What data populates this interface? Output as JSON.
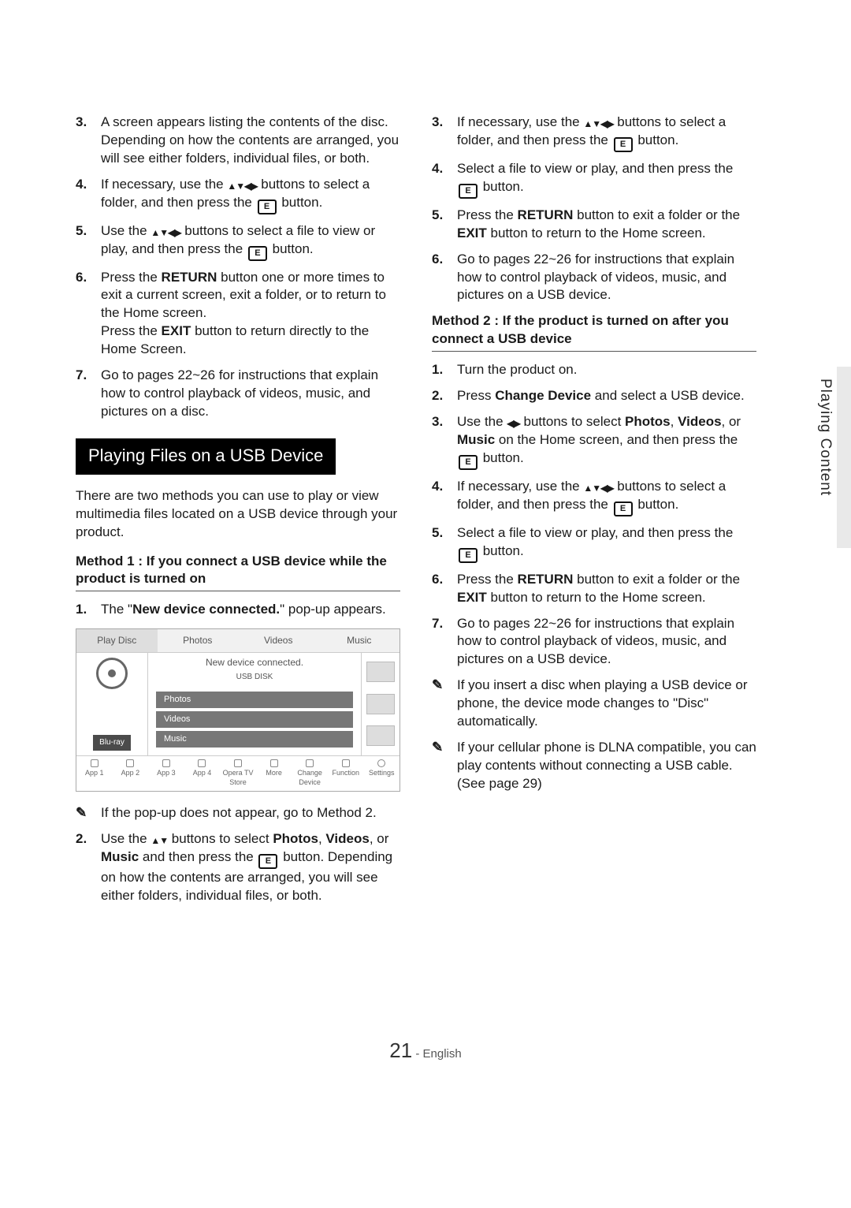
{
  "page": {
    "number": "21",
    "language_label": "- English"
  },
  "sidetab": {
    "label": "Playing Content"
  },
  "icons": {
    "dpad4": "▲▼◀▶",
    "dpad2ud": "▲▼",
    "dpad2lr": "◀▶",
    "enter_glyph": "E"
  },
  "left": {
    "steps_top": [
      {
        "n": "3.",
        "text": "A screen appears listing the contents of the disc. Depending on how the contents are arranged, you will see either folders, individual files, or both."
      },
      {
        "n": "4.",
        "segs": [
          {
            "t": "If necessary, use the "
          },
          {
            "dpad": "dpad4"
          },
          {
            "t": " buttons to select a folder, and then press the "
          },
          {
            "enter": true
          },
          {
            "t": " button."
          }
        ]
      },
      {
        "n": "5.",
        "segs": [
          {
            "t": "Use the "
          },
          {
            "dpad": "dpad4"
          },
          {
            "t": " buttons to select a file to view or play, and then press the "
          },
          {
            "enter": true
          },
          {
            "t": " button."
          }
        ]
      },
      {
        "n": "6.",
        "segs": [
          {
            "t": "Press the "
          },
          {
            "b": "RETURN"
          },
          {
            "t": " button one or more times to exit a current screen, exit a folder, or to return to the Home screen."
          },
          {
            "br": true
          },
          {
            "t": "Press the "
          },
          {
            "b": "EXIT"
          },
          {
            "t": " button to return directly to the Home Screen."
          }
        ]
      },
      {
        "n": "7.",
        "text": "Go to pages 22~26 for instructions that explain how to control playback of videos, music, and pictures on a disc."
      }
    ],
    "section_title": "Playing Files on a USB Device",
    "section_intro": "There are two methods you can use to play or view multimedia files located on a USB device through your product.",
    "method1_heading": "Method 1 : If you connect a USB device while the product is turned on",
    "method1_step1": {
      "n": "1.",
      "segs": [
        {
          "t": "The \""
        },
        {
          "b": "New device connected."
        },
        {
          "t": "\" pop-up appears."
        }
      ]
    },
    "ui_shot": {
      "tabs": [
        "Play Disc",
        "Photos",
        "Videos",
        "Music"
      ],
      "disc_label": "Blu-ray",
      "popup_line1": "New device connected.",
      "popup_line2": "USB DISK",
      "options": [
        "Photos",
        "Videos",
        "Music"
      ],
      "bottom": [
        "App 1",
        "App 2",
        "App 3",
        "App 4",
        "Opera TV Store",
        "More",
        "Change Device",
        "Function",
        "Settings"
      ]
    },
    "note1": "If the pop-up does not appear, go to Method 2.",
    "method1_step2": {
      "n": "2.",
      "segs": [
        {
          "t": "Use the "
        },
        {
          "dpad": "dpad2ud"
        },
        {
          "t": " buttons to select "
        },
        {
          "b": "Photos"
        },
        {
          "t": ", "
        },
        {
          "b": "Videos"
        },
        {
          "t": ", or "
        },
        {
          "b": "Music"
        },
        {
          "t": " and then press the "
        },
        {
          "enter": true
        },
        {
          "t": " button. Depending on how the contents are arranged, you will see either folders, individual files, or both."
        }
      ]
    }
  },
  "right": {
    "steps_top": [
      {
        "n": "3.",
        "segs": [
          {
            "t": "If necessary, use the "
          },
          {
            "dpad": "dpad4"
          },
          {
            "t": " buttons to select a folder, and then press the "
          },
          {
            "enter": true
          },
          {
            "t": " button."
          }
        ]
      },
      {
        "n": "4.",
        "segs": [
          {
            "t": "Select a file to view or play, and then press the "
          },
          {
            "enter": true
          },
          {
            "t": " button."
          }
        ]
      },
      {
        "n": "5.",
        "segs": [
          {
            "t": "Press the "
          },
          {
            "b": "RETURN"
          },
          {
            "t": " button to exit a folder or the "
          },
          {
            "b": "EXIT"
          },
          {
            "t": " button to return to the Home screen."
          }
        ]
      },
      {
        "n": "6.",
        "text": "Go to pages 22~26 for instructions that explain how to control playback of videos, music, and pictures on a USB device."
      }
    ],
    "method2_heading": "Method 2 : If the product is turned on after you connect a USB device",
    "method2_steps": [
      {
        "n": "1.",
        "text": "Turn the product on."
      },
      {
        "n": "2.",
        "segs": [
          {
            "t": "Press "
          },
          {
            "b": "Change Device"
          },
          {
            "t": " and select a USB device."
          }
        ]
      },
      {
        "n": "3.",
        "segs": [
          {
            "t": "Use the "
          },
          {
            "dpad": "dpad2lr"
          },
          {
            "t": " buttons to select "
          },
          {
            "b": "Photos"
          },
          {
            "t": ", "
          },
          {
            "b": "Videos"
          },
          {
            "t": ", or "
          },
          {
            "b": "Music"
          },
          {
            "t": " on the Home screen, and then press the "
          },
          {
            "enter": true
          },
          {
            "t": " button."
          }
        ]
      },
      {
        "n": "4.",
        "segs": [
          {
            "t": "If necessary, use the "
          },
          {
            "dpad": "dpad4"
          },
          {
            "t": " buttons to select a folder, and then press the "
          },
          {
            "enter": true
          },
          {
            "t": " button."
          }
        ]
      },
      {
        "n": "5.",
        "segs": [
          {
            "t": "Select a file to view or play, and then press the "
          },
          {
            "enter": true
          },
          {
            "t": " button."
          }
        ]
      },
      {
        "n": "6.",
        "segs": [
          {
            "t": "Press the "
          },
          {
            "b": "RETURN"
          },
          {
            "t": " button to exit a folder or the "
          },
          {
            "b": "EXIT"
          },
          {
            "t": " button to return to the Home screen."
          }
        ]
      },
      {
        "n": "7.",
        "text": "Go to pages 22~26 for instructions that explain how to control playback of videos, music, and pictures on a USB device."
      }
    ],
    "notes": [
      "If you insert a disc when playing a USB device or phone, the device mode changes to \"Disc\" automatically.",
      "If your cellular phone is DLNA compatible, you can play contents without connecting a USB cable. (See page 29)"
    ]
  }
}
